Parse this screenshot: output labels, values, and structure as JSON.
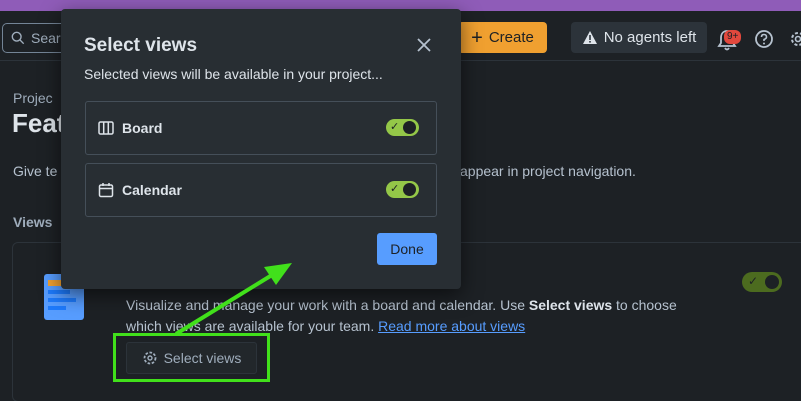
{
  "topbar": {
    "search_placeholder": "Sear",
    "create_label": "Create",
    "agents_label": "No agents left",
    "notifications_badge": "9+"
  },
  "page": {
    "breadcrumb": "Projec",
    "title": "Feat",
    "description_start": "Give te",
    "description_end": "appear in project navigation.",
    "views_heading": "Views"
  },
  "card": {
    "desc_text_1": "Visualize and manage your work with a board and calendar. Use ",
    "desc_bold": "Select views",
    "desc_text_2": " to choose which views are available for your team. ",
    "desc_link": "Read more about views",
    "toggle_on": true,
    "select_views_label": "Select views"
  },
  "modal": {
    "title": "Select views",
    "subtitle": "Selected views will be available in your project...",
    "views": [
      {
        "label": "Board",
        "enabled": true,
        "icon": "board-icon"
      },
      {
        "label": "Calendar",
        "enabled": true,
        "icon": "calendar-icon"
      }
    ],
    "done_label": "Done"
  },
  "colors": {
    "accent_create": "#f0a030",
    "toggle_on": "#94c748",
    "primary": "#579dff",
    "annotation": "#41e01b"
  }
}
